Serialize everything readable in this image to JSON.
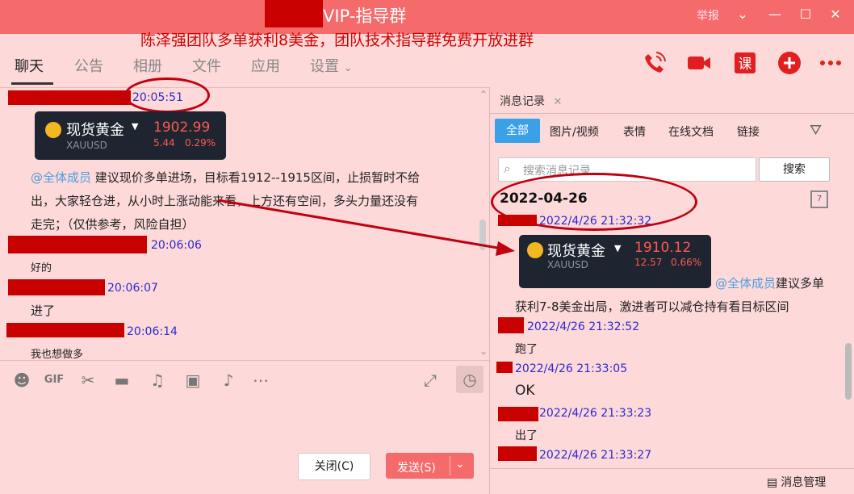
{
  "window": {
    "title": "VIP-指导群",
    "report": "举报"
  },
  "banner": "陈泽强团队多单获利8美金，团队技术指导群免费开放进群",
  "tabs": [
    "聊天",
    "公告",
    "相册",
    "文件",
    "应用",
    "设置"
  ],
  "chat": {
    "messages": [
      {
        "time": "20:05:51"
      },
      {
        "card": {
          "name": "现货黄金",
          "code": "XAUUSD",
          "price": "1902.99",
          "change": "5.44",
          "pct": "0.29%"
        }
      },
      {
        "mention": "@全体成员",
        "text_l1": " 建议现价多单进场，目标看1912--1915区间，止损暂时不给",
        "text_l2": "出，大家轻仓进，从小时上涨动能来看，上方还有空间，多头力量还没有",
        "text_l3": "走完；（仅供参考，风险自担）"
      },
      {
        "time": "20:06:06",
        "text": "好的"
      },
      {
        "time": "20:06:07",
        "text": "进了"
      },
      {
        "time": "20:06:14",
        "text": "我也想做多"
      }
    ],
    "close_label": "关闭(C)",
    "send_label": "发送(S)"
  },
  "history": {
    "tab_label": "消息记录",
    "filters": [
      "全部",
      "图片/视频",
      "表情",
      "在线文档",
      "链接"
    ],
    "search_placeholder": "搜索消息记录",
    "search_button": "搜索",
    "date": "2022-04-26",
    "entries": [
      {
        "time": "2022/4/26 21:32:32"
      },
      {
        "card": {
          "name": "现货黄金",
          "code": "XAUUSD",
          "price": "1910.12",
          "change": "12.57",
          "pct": "0.66%"
        }
      },
      {
        "mention": "@全体成员",
        "text_l1": "建议多单",
        "text_l2": "获利7-8美金出局，激进者可以减仓持有看目标区间"
      },
      {
        "time": "2022/4/26 21:32:52",
        "text": "跑了"
      },
      {
        "time": "2022/4/26 21:33:05",
        "text": "OK"
      },
      {
        "time": "2022/4/26 21:33:23",
        "text": "出了"
      },
      {
        "time": "2022/4/26 21:33:27"
      }
    ],
    "manage_label": "消息管理"
  }
}
